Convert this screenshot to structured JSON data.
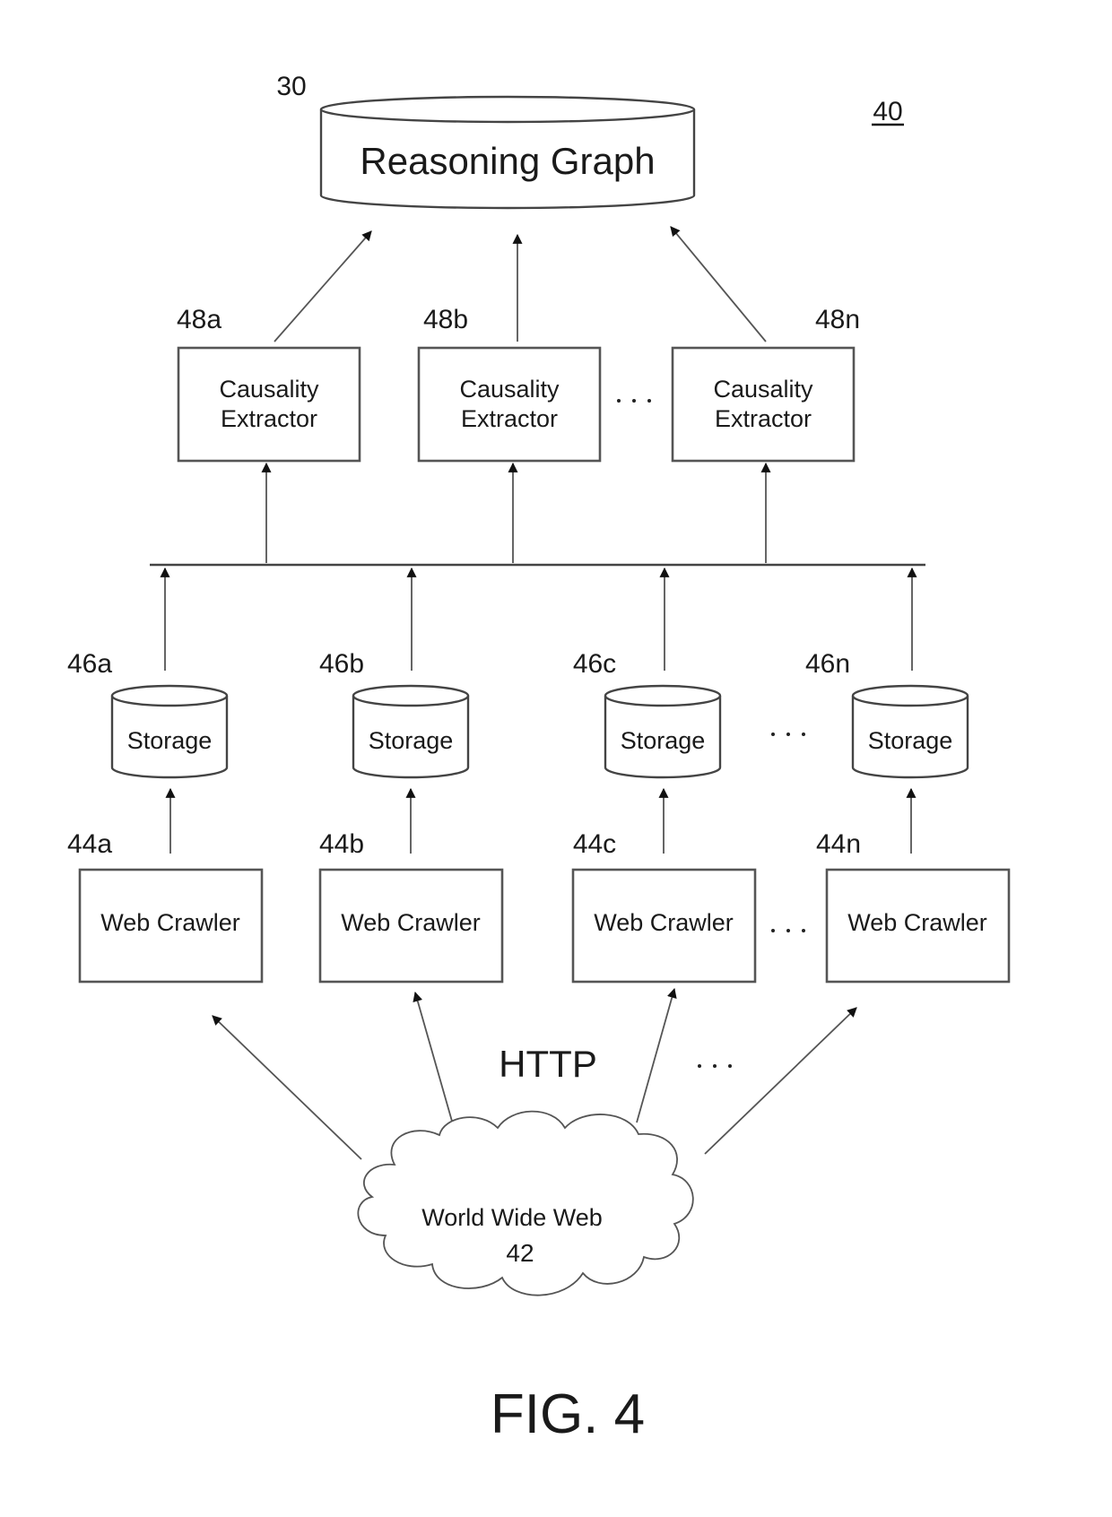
{
  "figure": {
    "title": "FIG. 4",
    "ref_system": "40"
  },
  "reasoning_graph": {
    "ref": "30",
    "label": "Reasoning Graph"
  },
  "extractors": [
    {
      "ref": "48a",
      "line1": "Causality",
      "line2": "Extractor"
    },
    {
      "ref": "48b",
      "line1": "Causality",
      "line2": "Extractor"
    },
    {
      "ref": "48n",
      "line1": "Causality",
      "line2": "Extractor"
    }
  ],
  "storages": [
    {
      "ref": "46a",
      "label": "Storage"
    },
    {
      "ref": "46b",
      "label": "Storage"
    },
    {
      "ref": "46c",
      "label": "Storage"
    },
    {
      "ref": "46n",
      "label": "Storage"
    }
  ],
  "crawlers": [
    {
      "ref": "44a",
      "label": "Web Crawler"
    },
    {
      "ref": "44b",
      "label": "Web Crawler"
    },
    {
      "ref": "44c",
      "label": "Web Crawler"
    },
    {
      "ref": "44n",
      "label": "Web Crawler"
    }
  ],
  "protocol_label": "HTTP",
  "web": {
    "label": "World Wide Web",
    "ref": "42"
  },
  "ellipsis": "· · ·"
}
